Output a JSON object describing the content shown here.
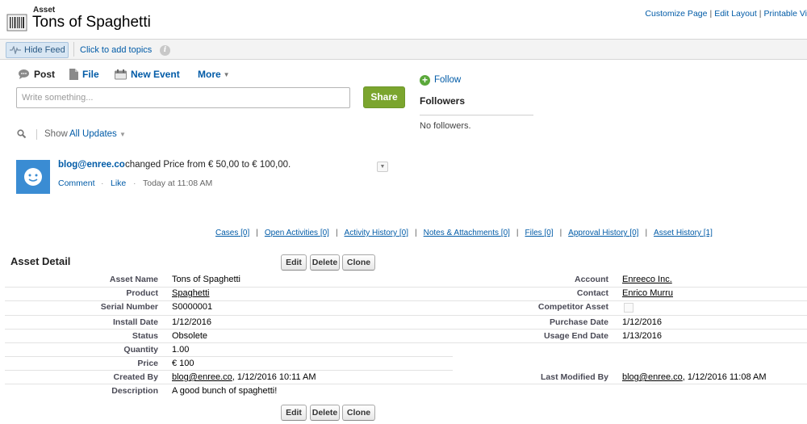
{
  "header": {
    "type_label": "Asset",
    "title": "Tons of Spaghetti",
    "links": [
      "Customize Page",
      "Edit Layout",
      "Printable Vi"
    ],
    "link_separator": "|"
  },
  "chatter": {
    "hide_feed_label": "Hide Feed",
    "topics_label": "Click to add topics"
  },
  "publisher": {
    "tabs": {
      "post": "Post",
      "file": "File",
      "new_event": "New Event",
      "more": "More"
    },
    "input_placeholder": "Write something...",
    "share_label": "Share"
  },
  "followers": {
    "follow_label": "Follow",
    "heading": "Followers",
    "empty_text": "No followers."
  },
  "feed": {
    "show_label": "Show",
    "filter_value": "All Updates",
    "items": [
      {
        "author": "blog@enree.co",
        "text": "changed Price from € 50,00 to € 100,00.",
        "comment_label": "Comment",
        "like_label": "Like",
        "separator": "·",
        "time": "Today at 11:08 AM"
      }
    ]
  },
  "related_lists": [
    {
      "label": "Cases",
      "count": "[0]"
    },
    {
      "label": "Open Activities",
      "count": "[0]"
    },
    {
      "label": "Activity History",
      "count": "[0]"
    },
    {
      "label": "Notes & Attachments",
      "count": "[0]"
    },
    {
      "label": "Files",
      "count": "[0]"
    },
    {
      "label": "Approval History",
      "count": "[0]"
    },
    {
      "label": "Asset History",
      "count": "[1]"
    }
  ],
  "related_separator": "|",
  "detail": {
    "title": "Asset Detail",
    "buttons": {
      "edit": "Edit",
      "delete": "Delete",
      "clone": "Clone"
    },
    "left_fields": [
      {
        "label": "Asset Name",
        "value": "Tons of Spaghetti"
      },
      {
        "label": "Product",
        "value": "Spaghetti"
      },
      {
        "label": "Serial Number",
        "value": "S0000001"
      },
      {
        "label": "Install Date",
        "value": "1/12/2016"
      },
      {
        "label": "Status",
        "value": "Obsolete"
      },
      {
        "label": "Quantity",
        "value": "1.00"
      },
      {
        "label": "Price",
        "value": "€ 100"
      },
      {
        "label": "Created By",
        "value": "blog@enree.co",
        "suffix": ", 1/12/2016 10:11 AM"
      },
      {
        "label": "Description",
        "value": "A good bunch of spaghetti!"
      }
    ],
    "right_fields": [
      {
        "label": "Account",
        "value": "Enreeco Inc."
      },
      {
        "label": "Contact",
        "value": "Enrico Murru"
      },
      {
        "label": "Competitor Asset",
        "value": false
      },
      {
        "label": "Purchase Date",
        "value": "1/12/2016"
      },
      {
        "label": "Usage End Date",
        "value": "1/13/2016"
      },
      {
        "label": "Last Modified By",
        "value": "blog@enree.co",
        "suffix": ", 1/12/2016 11:08 AM"
      }
    ]
  },
  "colors": {
    "link": "#015ba7",
    "share_button": "#7ba52e",
    "avatar": "#3a8cd3",
    "follow_icon": "#5aa83a"
  },
  "icons": [
    "asset-barcode-icon",
    "pulse-icon",
    "info-icon",
    "chat-bubble-icon",
    "file-icon",
    "event-icon",
    "plus-icon",
    "search-icon",
    "avatar-smiley-icon"
  ]
}
